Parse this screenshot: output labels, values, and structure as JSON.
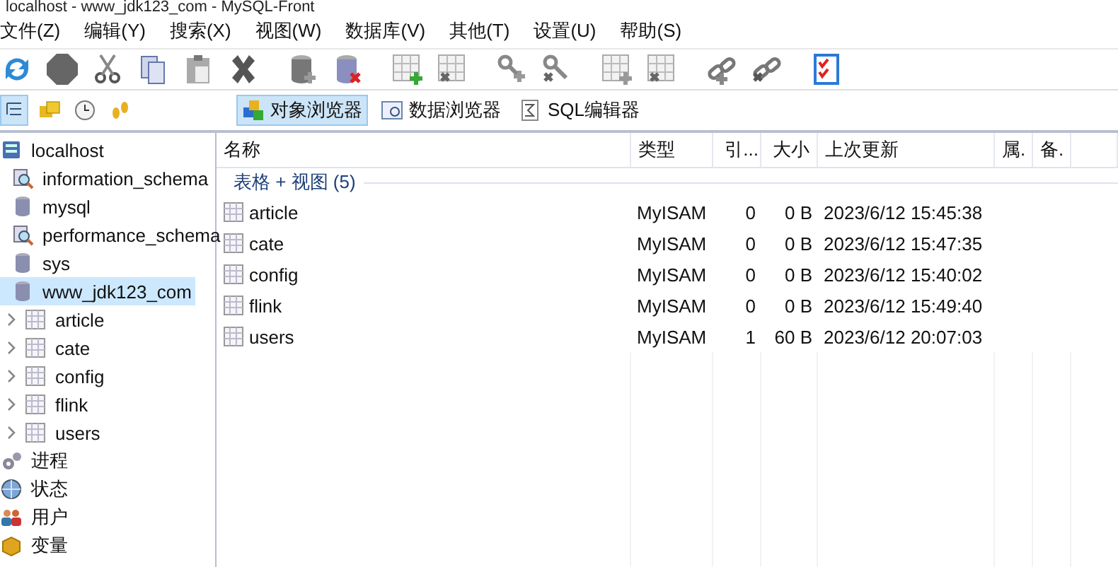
{
  "window": {
    "title": "localhost - www_jdk123_com - MySQL-Front"
  },
  "menu": [
    "文件(Z)",
    "编辑(Y)",
    "搜索(X)",
    "视图(W)",
    "数据库(V)",
    "其他(T)",
    "设置(U)",
    "帮助(S)"
  ],
  "view_toggles": [
    {
      "kind": "tree",
      "selected": true
    },
    {
      "kind": "folders",
      "selected": false
    },
    {
      "kind": "history",
      "selected": false
    },
    {
      "kind": "steps",
      "selected": false
    }
  ],
  "tabs": [
    {
      "label": "对象浏览器",
      "kind": "objects",
      "selected": true
    },
    {
      "label": "数据浏览器",
      "kind": "data",
      "selected": false
    },
    {
      "label": "SQL编辑器",
      "kind": "sql",
      "selected": false
    }
  ],
  "tree": [
    {
      "label": "localhost",
      "kind": "server",
      "selected": false,
      "children": [
        {
          "label": "information_schema",
          "kind": "schema",
          "selected": false
        },
        {
          "label": "mysql",
          "kind": "database",
          "selected": false
        },
        {
          "label": "performance_schema",
          "kind": "schema",
          "selected": false
        },
        {
          "label": "sys",
          "kind": "database",
          "selected": false
        },
        {
          "label": "www_jdk123_com",
          "kind": "database",
          "selected": true,
          "children": [
            {
              "label": "article",
              "kind": "table",
              "selected": false,
              "expanded": false
            },
            {
              "label": "cate",
              "kind": "table",
              "selected": false,
              "expanded": false
            },
            {
              "label": "config",
              "kind": "table",
              "selected": false,
              "expanded": false
            },
            {
              "label": "flink",
              "kind": "table",
              "selected": false,
              "expanded": false
            },
            {
              "label": "users",
              "kind": "table",
              "selected": false,
              "expanded": false
            }
          ]
        }
      ]
    },
    {
      "label": "进程",
      "kind": "processes",
      "selected": false
    },
    {
      "label": "状态",
      "kind": "status",
      "selected": false
    },
    {
      "label": "用户",
      "kind": "users",
      "selected": false
    },
    {
      "label": "变量",
      "kind": "variables",
      "selected": false
    }
  ],
  "table": {
    "columns": [
      "名称",
      "类型",
      "引...",
      "大小",
      "上次更新",
      "属.",
      "备."
    ],
    "group": "表格 + 视图 (5)",
    "rows": [
      [
        "article",
        "MyISAM",
        "0",
        "0 B",
        "2023/6/12 15:45:38"
      ],
      [
        "cate",
        "MyISAM",
        "0",
        "0 B",
        "2023/6/12 15:47:35"
      ],
      [
        "config",
        "MyISAM",
        "0",
        "0 B",
        "2023/6/12 15:40:02"
      ],
      [
        "flink",
        "MyISAM",
        "0",
        "0 B",
        "2023/6/12 15:49:40"
      ],
      [
        "users",
        "MyISAM",
        "1",
        "60 B",
        "2023/6/12 20:07:03"
      ]
    ]
  }
}
